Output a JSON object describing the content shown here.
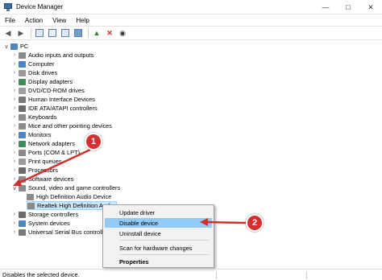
{
  "title": "Device Manager",
  "menu": [
    "File",
    "Action",
    "View",
    "Help"
  ],
  "tree": {
    "root": "PC",
    "categories": [
      "Audio inputs and outputs",
      "Computer",
      "Disk drives",
      "Display adapters",
      "DVD/CD-ROM drives",
      "Human Interface Devices",
      "IDE ATA/ATAPI controllers",
      "Keyboards",
      "Mice and other pointing devices",
      "Monitors",
      "Network adapters",
      "Ports (COM & LPT)",
      "Print queues",
      "Processors",
      "Software devices",
      "Sound, video and game controllers"
    ],
    "sound_children": [
      "High Definition Audio Device",
      "Realtek High Definition Audio"
    ],
    "after": [
      "Storage controllers",
      "System devices",
      "Universal Serial Bus controllers"
    ]
  },
  "context_menu": {
    "update": "Update driver",
    "disable": "Disable device",
    "uninstall": "Uninstall device",
    "scan": "Scan for hardware changes",
    "properties": "Properties"
  },
  "status": "Disables the selected device.",
  "annotations": [
    "1",
    "2"
  ],
  "colors": {
    "annotation": "#d32f2f",
    "highlight": "#91c9f7",
    "selection": "#cce8ff"
  }
}
